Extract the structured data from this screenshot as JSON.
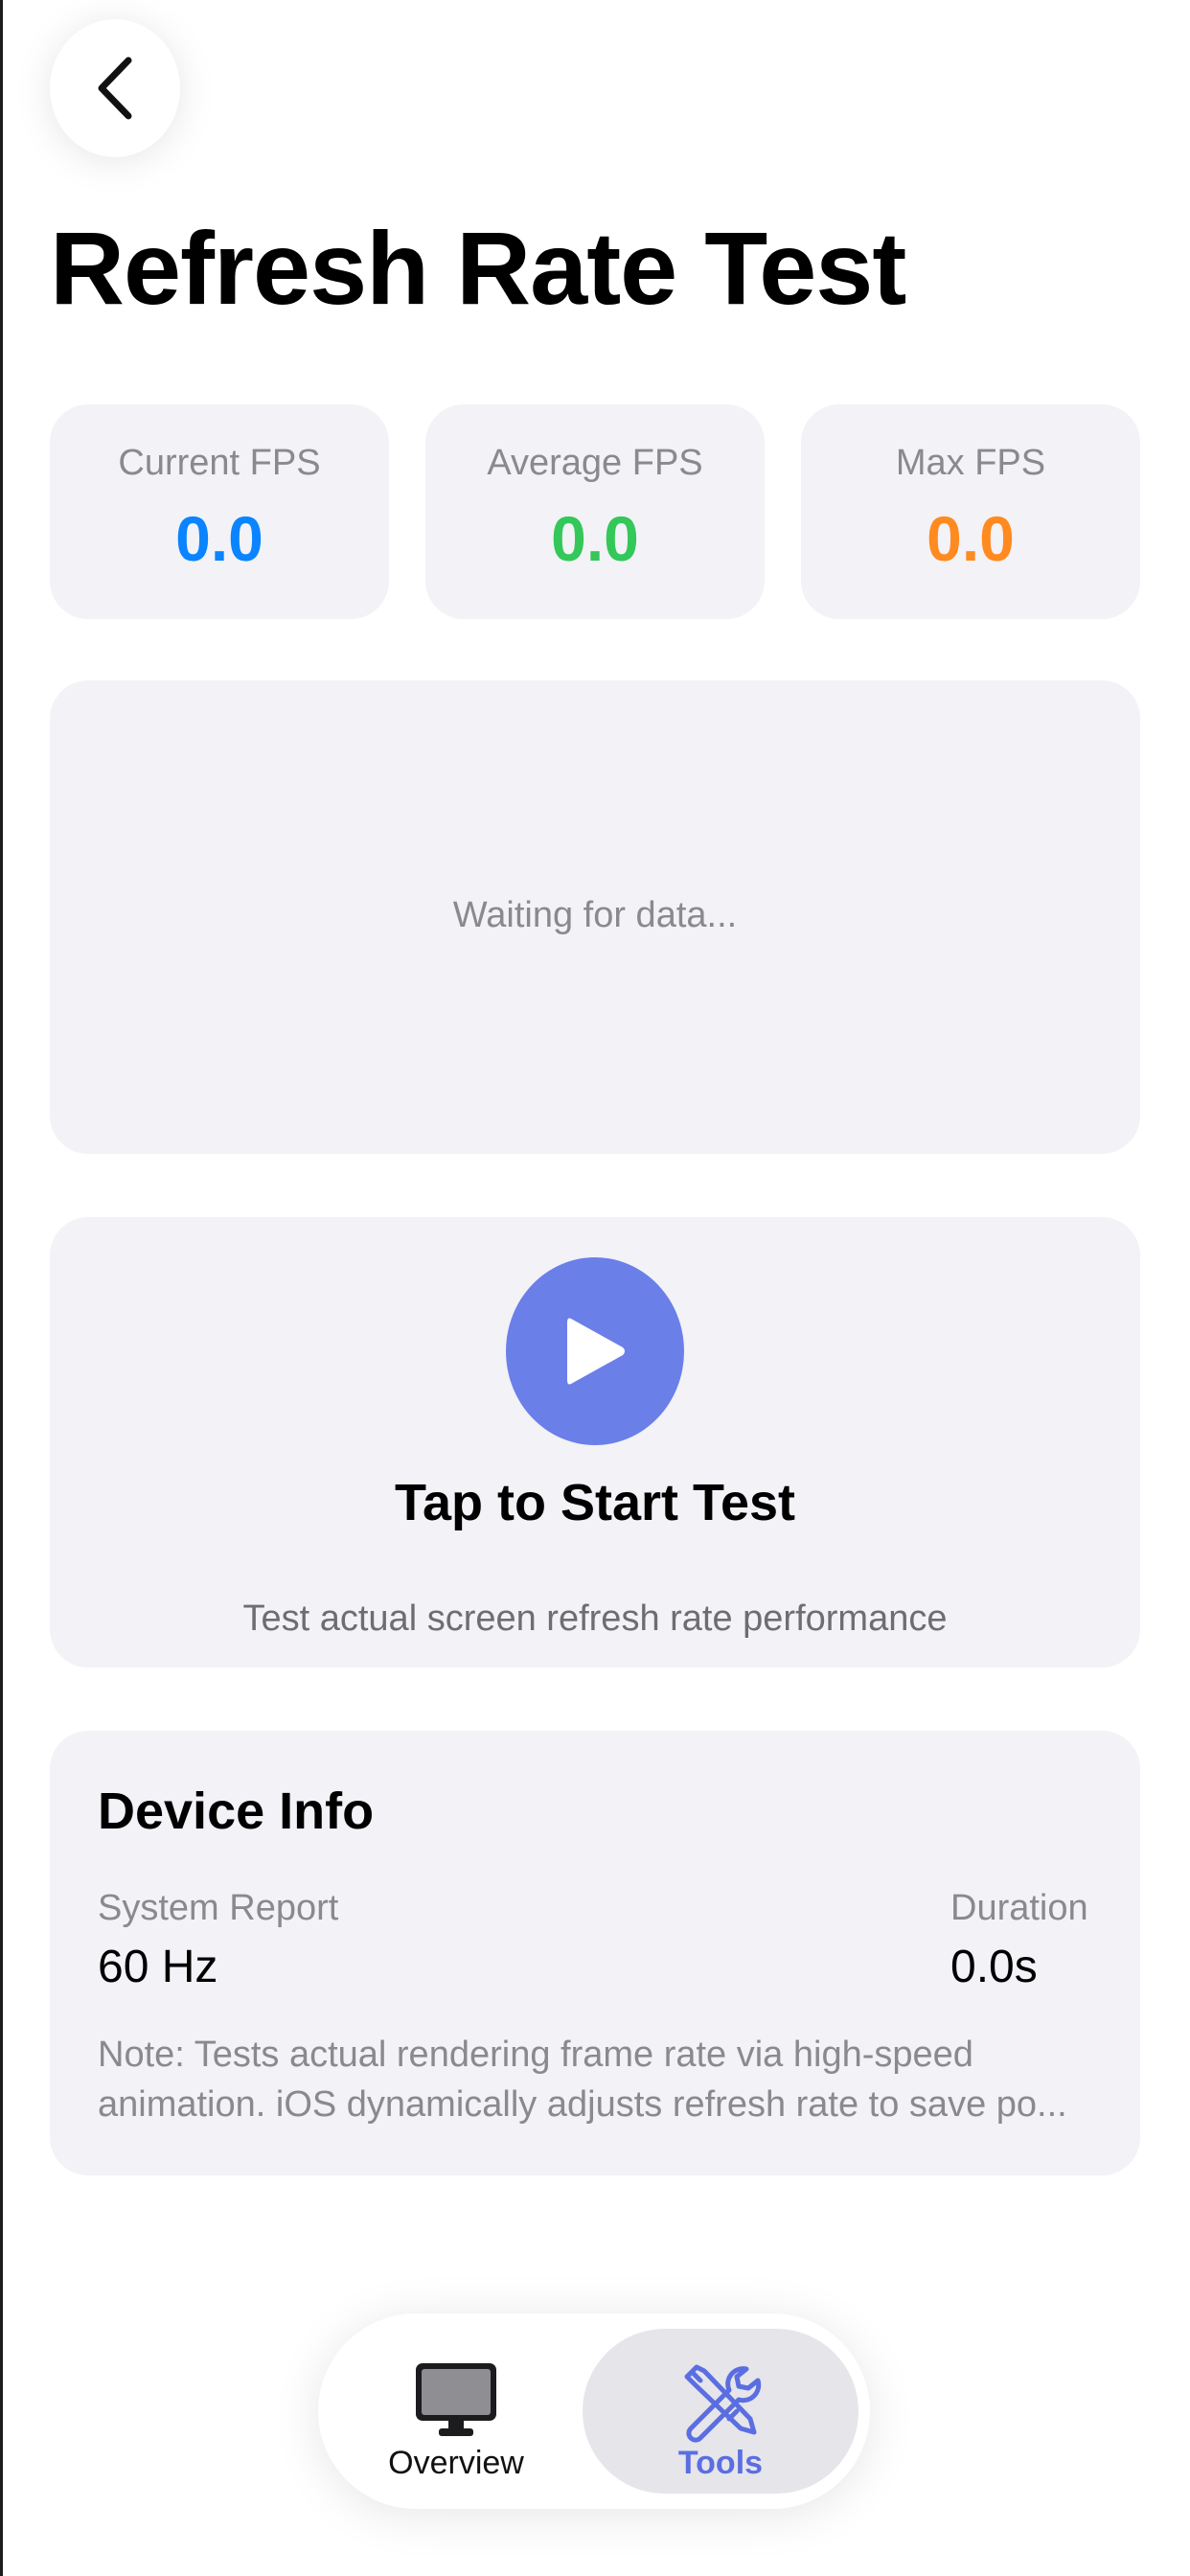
{
  "header": {
    "back_icon": "chevron-left-icon",
    "title": "Refresh Rate Test"
  },
  "stats": [
    {
      "label": "Current FPS",
      "value": "0.0",
      "color": "#0a84ff"
    },
    {
      "label": "Average FPS",
      "value": "0.0",
      "color": "#34c759"
    },
    {
      "label": "Max FPS",
      "value": "0.0",
      "color": "#ff8a1f"
    }
  ],
  "chart": {
    "placeholder": "Waiting for data..."
  },
  "start": {
    "icon": "play-icon",
    "button_color": "#6b7fe9",
    "title": "Tap to Start Test",
    "subtitle": "Test actual screen refresh rate performance"
  },
  "device_info": {
    "title": "Device Info",
    "system_report_label": "System Report",
    "system_report_value": "60 Hz",
    "duration_label": "Duration",
    "duration_value": "0.0s",
    "note_line1": "Note: Tests actual rendering frame rate via high-speed",
    "note_line2": "animation. iOS dynamically adjusts refresh rate to save po..."
  },
  "tab_bar": {
    "accent_color": "#5b6ee1",
    "tabs": [
      {
        "label": "Overview",
        "icon": "monitor-icon",
        "selected": false
      },
      {
        "label": "Tools",
        "icon": "tools-icon",
        "selected": true
      }
    ]
  }
}
